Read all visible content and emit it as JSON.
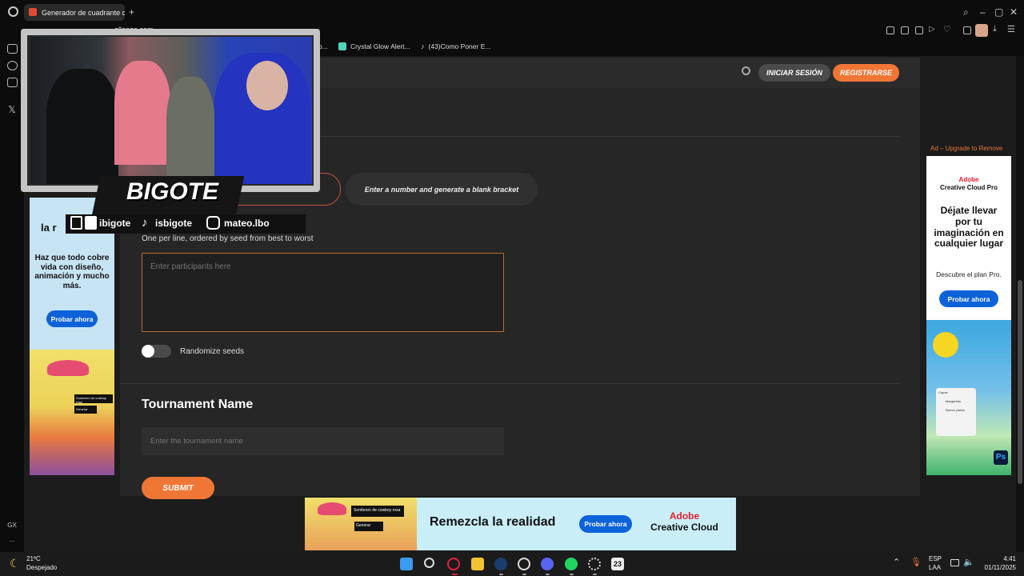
{
  "browser": {
    "tab_title": "Generador de cuadrante c",
    "address_partial": "allonge.com",
    "bookmarks": [
      {
        "label": "Crystal Glow Alert..."
      },
      {
        "label": "(43)Como Poner E..."
      }
    ],
    "partial_bookmark": "o..."
  },
  "header": {
    "login_label": "INICIAR SESIÓN",
    "register_label": "REGISTRARSE"
  },
  "form": {
    "blank_bracket_label": "Enter a number and generate a blank bracket",
    "participants_hint": "One per line, ordered by seed from best to worst",
    "participants_placeholder": "Enter participants here",
    "randomize_label": "Randomize seeds",
    "tournament_title": "Tournament Name",
    "tournament_placeholder": "Enter the tournament name",
    "submit_label": "SUBMIT"
  },
  "ads": {
    "note": "Ad – Upgrade to Remove",
    "left": {
      "headline_partial": "la r",
      "body": "Haz que todo cobre vida con diseño, animación y mucho más.",
      "cta": "Probar ahora",
      "mini_card": "Sombrero de cowboy rosa",
      "mini_button": "Generar"
    },
    "right": {
      "brand_line1": "Adobe",
      "brand_line2": "Creative Cloud Pro",
      "headline": "Déjate llevar por tu imaginación en cualquier lugar",
      "sub": "Descubre el plan Pro.",
      "cta": "Probar ahora",
      "app_badge": "Ps",
      "panel_items": [
        "Capas",
        "Margaritas",
        "Nueva planta"
      ]
    },
    "bottom": {
      "headline": "Remezcla la realidad",
      "cta": "Probar ahora",
      "brand_line1": "Adobe",
      "brand_line2": "Creative Cloud",
      "mini_card": "Sombrero de cowboy rosa",
      "mini_button": "Generar"
    }
  },
  "overlay": {
    "name": "BIGOTE",
    "socials": [
      "ibigote",
      "isbigote",
      "mateo.lbo"
    ]
  },
  "sidebar": {
    "gx_label": "GX",
    "more_label": "..."
  },
  "taskbar": {
    "temperature": "21ºC",
    "weather": "Despejado",
    "language": "ESP",
    "region": "LAA",
    "time": "4:41",
    "date": "01/11/2025",
    "calendar_badge": "23"
  }
}
